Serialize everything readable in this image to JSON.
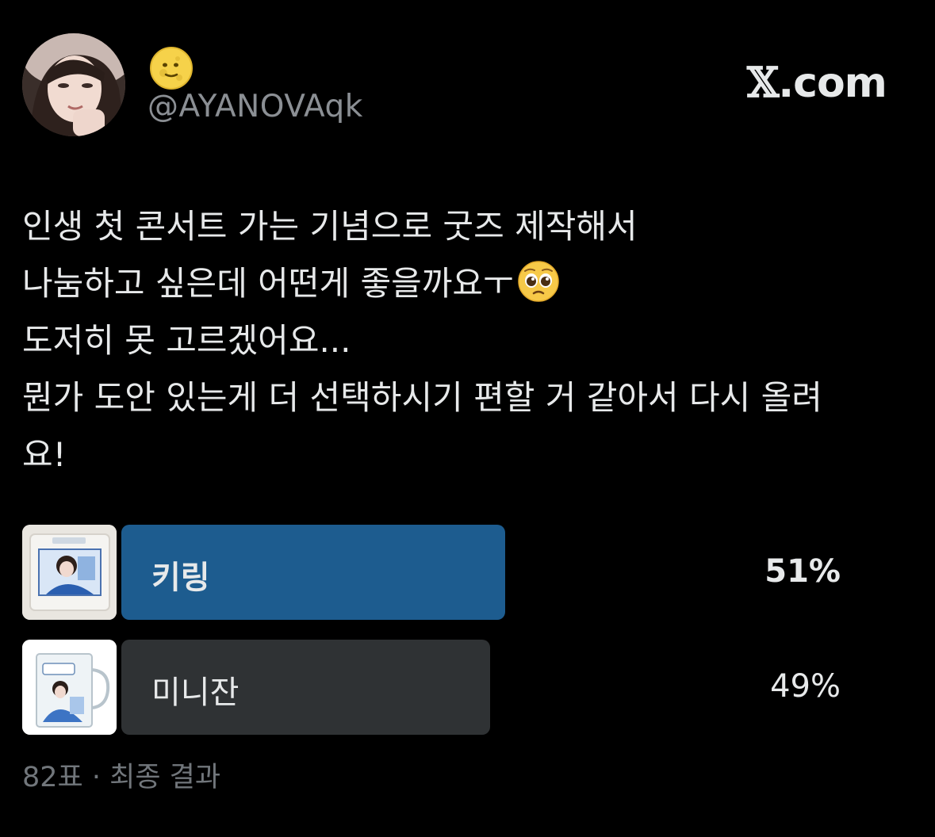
{
  "author": {
    "display_name_icon": "full-moon-face-emoji",
    "handle": "@AYANOVAqk",
    "avatar_icon": "profile-photo"
  },
  "brand": {
    "x_mark": "𝕏",
    "domain": ".com"
  },
  "tweet": {
    "lines": [
      "인생 첫 콘서트 가는 기념으로 굿즈 제작해서",
      "나눔하고 싶은데 어떤게 좋을까요ㅜ",
      "도저히 못 고르겠어요...",
      "뭔가 도안 있는게 더 선택하시기 편할 거 같아서 다시 올려",
      "요!"
    ],
    "emoji_after_line_2": "pleading-face-emoji"
  },
  "poll": {
    "options": [
      {
        "label": "키링",
        "percent_text": "51%",
        "percent": 51,
        "winner": true,
        "thumbnail_icon": "keyring-photo-thumbnail"
      },
      {
        "label": "미니잔",
        "percent_text": "49%",
        "percent": 49,
        "winner": false,
        "thumbnail_icon": "mini-glass-mug-thumbnail"
      }
    ],
    "meta": "82표 · 최종 결과"
  },
  "colors": {
    "background": "#000000",
    "text": "#e7e9ea",
    "muted": "#71767b",
    "winner_bar": "#1d5c8f",
    "other_bar": "#2f3234"
  }
}
